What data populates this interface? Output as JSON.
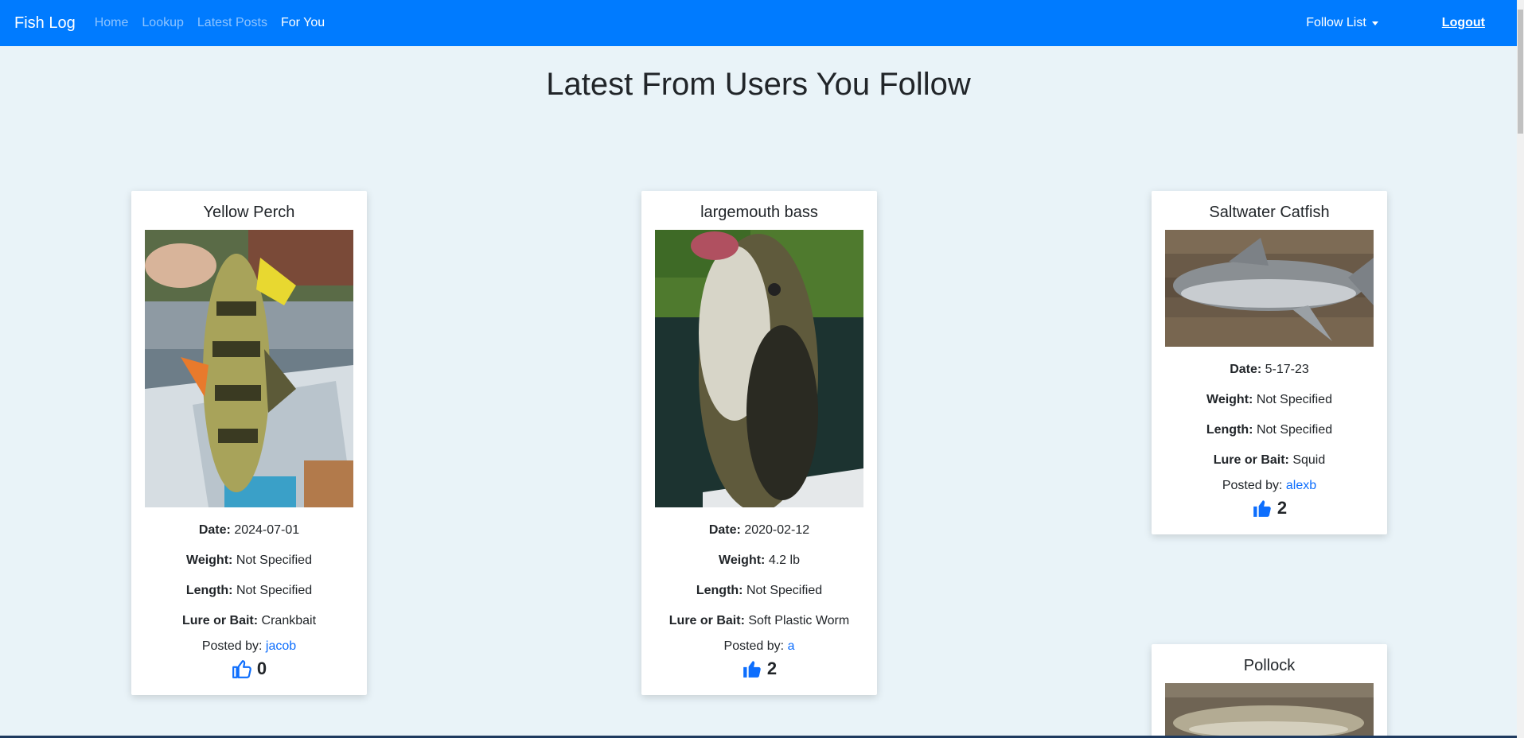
{
  "nav": {
    "brand": "Fish Log",
    "links": [
      "Home",
      "Lookup",
      "Latest Posts",
      "For You"
    ],
    "follow_list": "Follow List",
    "logout": "Logout"
  },
  "page_title": "Latest From Users You Follow",
  "labels": {
    "date": "Date:",
    "weight": "Weight:",
    "length": "Length:",
    "lure": "Lure or Bait:",
    "posted_by": "Posted by:"
  },
  "cards": [
    {
      "title": "Yellow Perch",
      "date": "2024-07-01",
      "weight": "Not Specified",
      "length": "Not Specified",
      "lure": "Crankbait",
      "user": "jacob",
      "likes": "0"
    },
    {
      "title": "largemouth bass",
      "date": "2020-02-12",
      "weight": "4.2 lb",
      "length": "Not Specified",
      "lure": "Soft Plastic Worm",
      "user": "a",
      "likes": "2"
    },
    {
      "title": "Saltwater Catfish",
      "date": "5-17-23",
      "weight": "Not Specified",
      "length": "Not Specified",
      "lure": "Squid",
      "user": "alexb",
      "likes": "2"
    },
    {
      "title": "Pollock"
    }
  ],
  "colors": {
    "navbar": "#007bff",
    "background": "#e9f3f8",
    "link": "#0d6efd"
  },
  "icons": {
    "like_outline": "thumbs-up-outline-icon",
    "like_filled": "thumbs-up-filled-icon"
  }
}
